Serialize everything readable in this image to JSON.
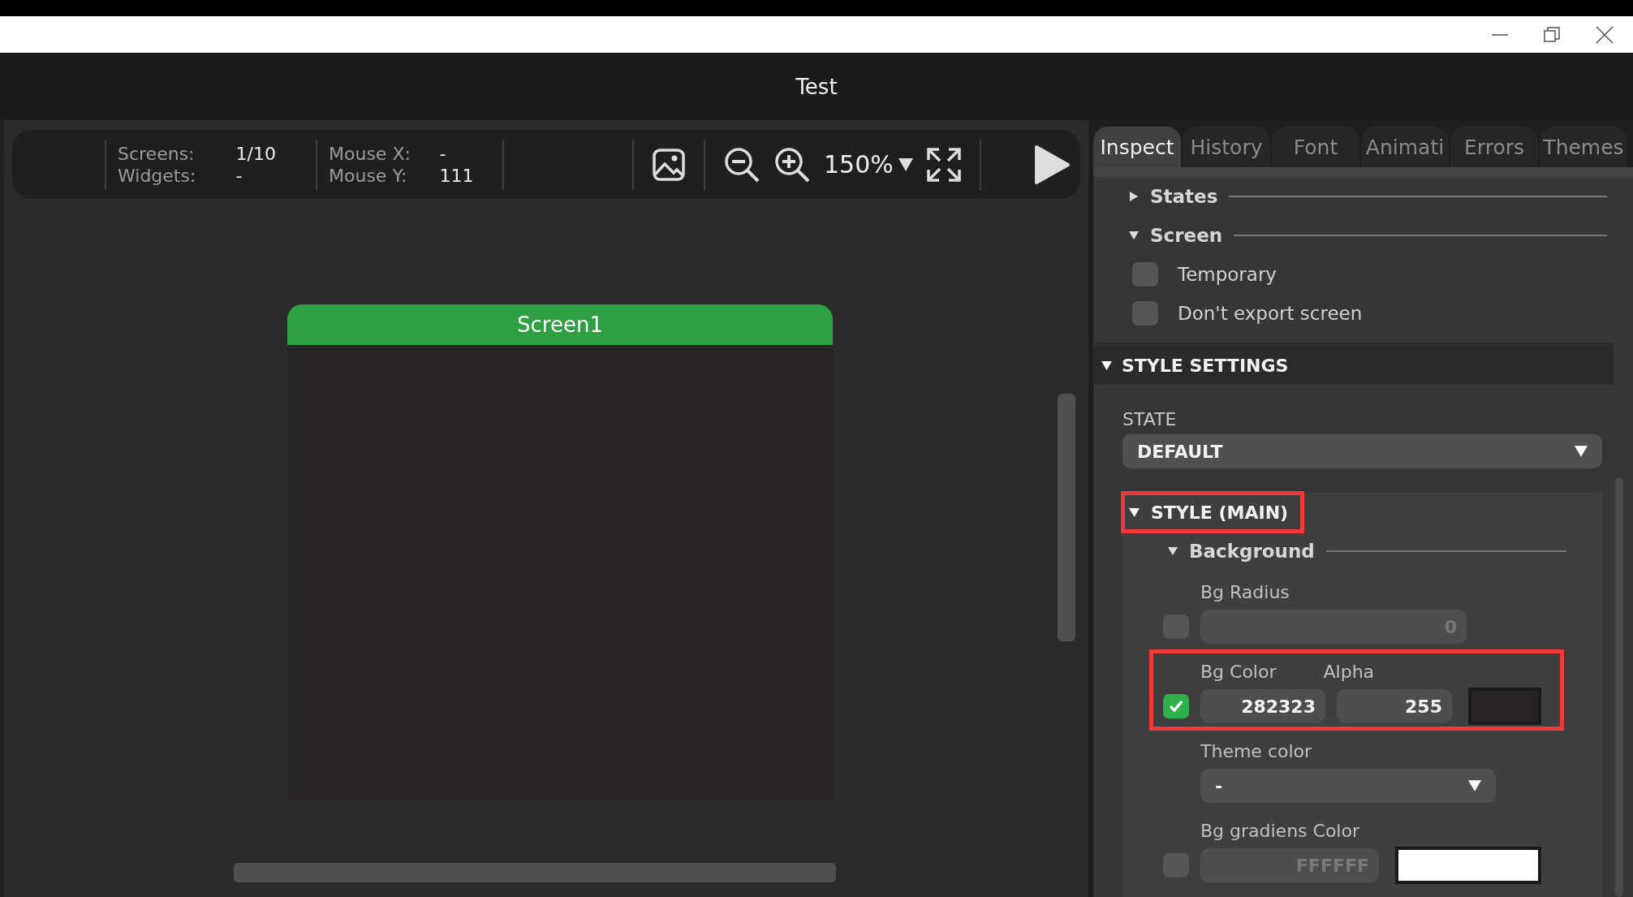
{
  "window": {
    "title": "Test"
  },
  "toolbar": {
    "stats": [
      {
        "label": "Screens:",
        "value": "1/10"
      },
      {
        "label": "Widgets:",
        "value": "-"
      },
      {
        "label": "Mouse X:",
        "value": "-"
      },
      {
        "label": "Mouse Y:",
        "value": "111"
      }
    ],
    "zoom": "150%"
  },
  "canvas": {
    "screen_title": "Screen1"
  },
  "tabs": [
    {
      "label": "Inspect",
      "selected": true
    },
    {
      "label": "History",
      "selected": false
    },
    {
      "label": "Font",
      "selected": false
    },
    {
      "label": "Animati",
      "selected": false
    },
    {
      "label": "Errors",
      "selected": false
    },
    {
      "label": "Themes",
      "selected": false
    }
  ],
  "states_section": {
    "title": "States",
    "expanded": false
  },
  "screen_section": {
    "title": "Screen",
    "expanded": true,
    "options": [
      {
        "label": "Temporary",
        "checked": false
      },
      {
        "label": "Don't export screen",
        "checked": false
      }
    ]
  },
  "style_settings": {
    "title": "STYLE SETTINGS",
    "expanded": true,
    "state_label": "STATE",
    "state_value": "DEFAULT",
    "style_group": {
      "title": "STYLE (MAIN)",
      "expanded": true,
      "highlighted": true
    },
    "background": {
      "title": "Background",
      "expanded": true
    },
    "props": [
      {
        "kind": "number",
        "label": "Bg Radius",
        "enabled": false,
        "value": "0",
        "highlighted": false
      },
      {
        "kind": "color",
        "label": "Bg Color",
        "alpha_label": "Alpha",
        "enabled": true,
        "value": "282323",
        "alpha": "255",
        "color": "#282323",
        "highlighted": true
      },
      {
        "kind": "select",
        "label": "Theme color",
        "value": "-",
        "highlighted": false
      },
      {
        "kind": "swatch",
        "label": "Bg gradiens Color",
        "enabled": false,
        "value": "FFFFFF",
        "color": "#ffffff",
        "highlighted": false
      }
    ]
  }
}
